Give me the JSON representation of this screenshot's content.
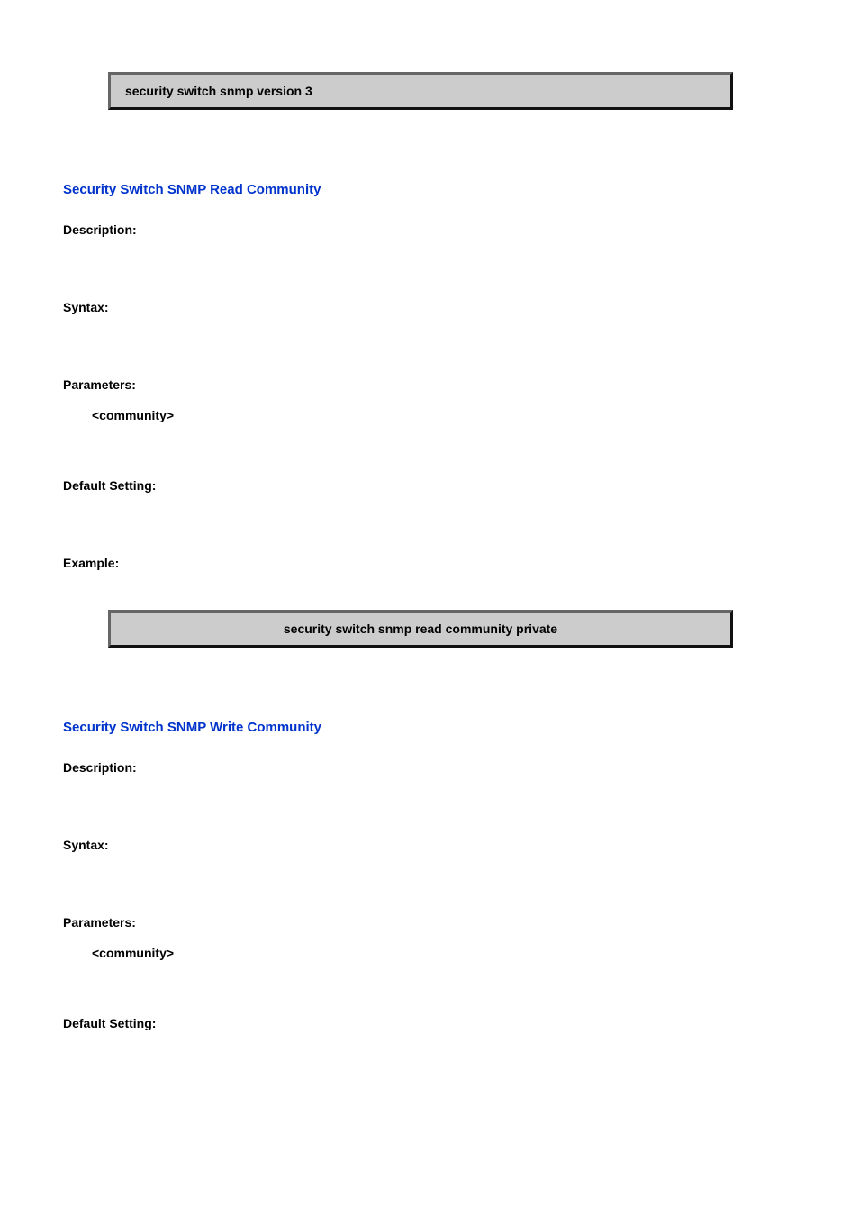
{
  "box1": {
    "text": "security switch snmp version 3"
  },
  "section1": {
    "title": "Security Switch SNMP Read Community",
    "description_label": "Description:",
    "syntax_label": "Syntax:",
    "parameters_label": "Parameters:",
    "param1": "<community>",
    "default_setting_label": "Default Setting:",
    "example_label": "Example:",
    "example_box": "security switch snmp read community private"
  },
  "section2": {
    "title": "Security Switch SNMP Write Community",
    "description_label": "Description:",
    "syntax_label": "Syntax:",
    "parameters_label": "Parameters:",
    "param1": "<community>",
    "default_setting_label": "Default Setting:"
  }
}
